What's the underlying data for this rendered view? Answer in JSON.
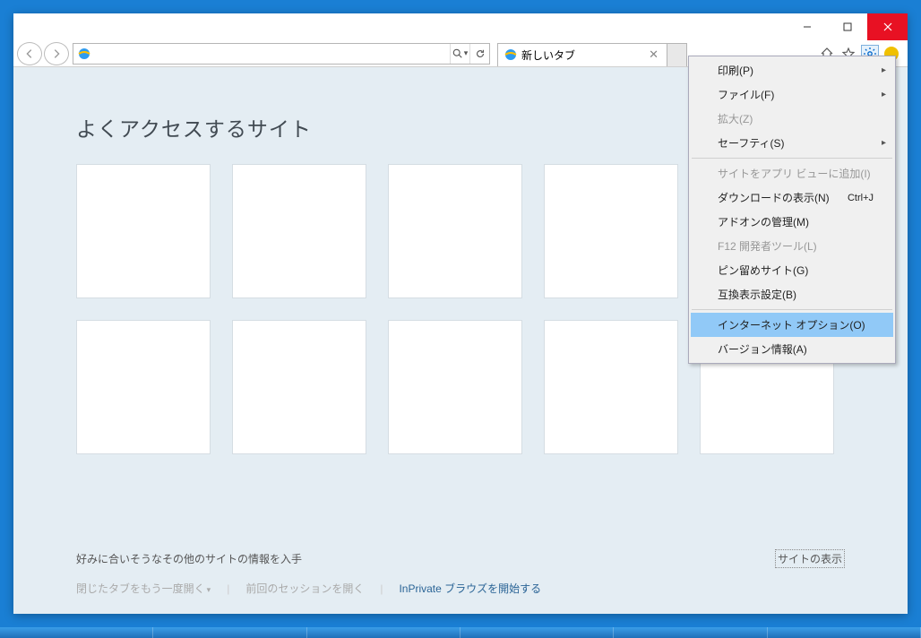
{
  "tab": {
    "title": "新しいタブ"
  },
  "page": {
    "heading": "よくアクセスするサイト",
    "info_text": "好みに合いそうなその他のサイトの情報を入手",
    "show_sites": "サイトの表示",
    "reopen_closed": "閉じたタブをもう一度開く",
    "reopen_session": "前回のセッションを開く",
    "inprivate": "InPrivate ブラウズを開始する"
  },
  "menu": {
    "print": "印刷(P)",
    "file": "ファイル(F)",
    "zoom": "拡大(Z)",
    "safety": "セーフティ(S)",
    "add_to_apps": "サイトをアプリ ビューに追加(I)",
    "downloads": "ダウンロードの表示(N)",
    "downloads_shortcut": "Ctrl+J",
    "addons": "アドオンの管理(M)",
    "f12": "F12 開発者ツール(L)",
    "pinned": "ピン留めサイト(G)",
    "compat": "互換表示設定(B)",
    "options": "インターネット オプション(O)",
    "about": "バージョン情報(A)"
  }
}
